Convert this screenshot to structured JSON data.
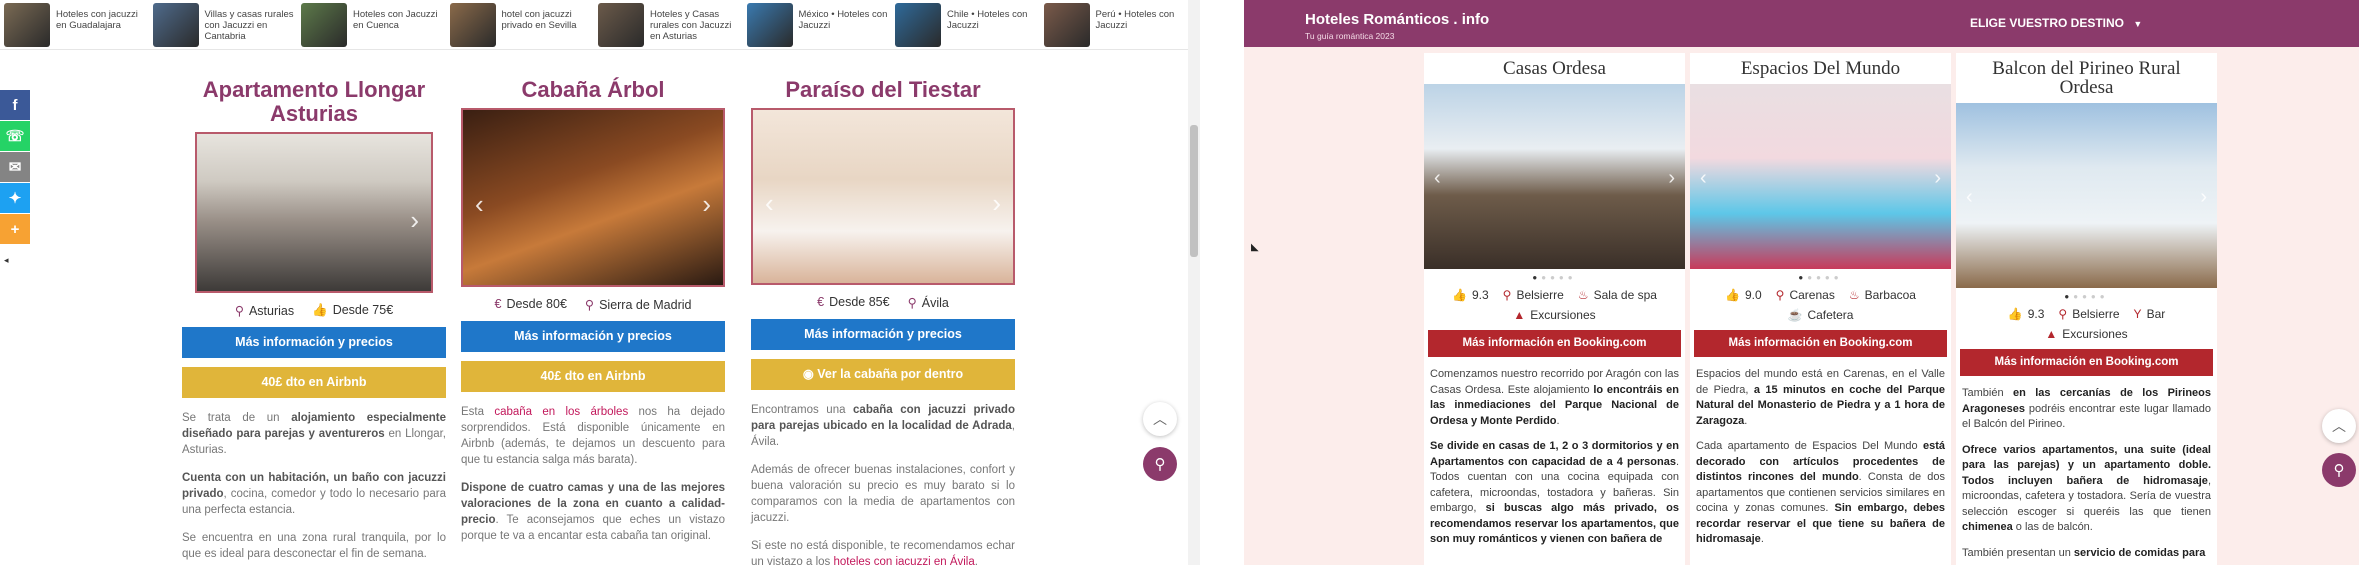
{
  "left": {
    "strip": [
      {
        "text": "Hoteles con jacuzzi en Guadalajara",
        "color": "#7a6a54"
      },
      {
        "text": "Villas y casas rurales con Jacuzzi en Cantabria",
        "color": "#4f6b8c"
      },
      {
        "text": "Hoteles con Jacuzzi en Cuenca",
        "color": "#5d7a4a"
      },
      {
        "text": "hotel con jacuzzi privado en Sevilla",
        "color": "#8a6a4a"
      },
      {
        "text": "Hoteles y Casas rurales con Jacuzzi en Asturias",
        "color": "#6b5a4a"
      },
      {
        "text": "México • Hoteles con Jacuzzi",
        "color": "#3a7ab0"
      },
      {
        "text": "Chile • Hoteles con Jacuzzi",
        "color": "#2f6a9a"
      },
      {
        "text": "Perú • Hoteles con Jacuzzi",
        "color": "#7a5a4a"
      }
    ],
    "share": [
      {
        "icon": "facebook-icon",
        "glyph": "f",
        "color": "#3b5998"
      },
      {
        "icon": "whatsapp-icon",
        "glyph": "☏",
        "color": "#25d366"
      },
      {
        "icon": "email-icon",
        "glyph": "✉",
        "color": "#848484"
      },
      {
        "icon": "twitter-icon",
        "glyph": "✦",
        "color": "#1da1f2"
      },
      {
        "icon": "more-icon",
        "glyph": "+",
        "color": "#f7a233"
      }
    ],
    "cards": [
      {
        "title": "Apartamento Llongar Asturias",
        "location": "Asturias",
        "price": "Desde 75€",
        "price_first": false,
        "btn_primary": "Más información y precios",
        "btn_secondary": "40£ dto en Airbnb",
        "paragraphs": [
          [
            {
              "t": "Se trata de un "
            },
            {
              "b": "alojamiento especialmente diseñado para parejas y aventureros"
            },
            {
              "t": " en Llongar, Asturias."
            }
          ],
          [
            {
              "b": "Cuenta con un habitación, un baño con jacuzzi privado"
            },
            {
              "t": ", cocina, comedor y todo lo necesario para una perfecta estancia."
            }
          ],
          [
            {
              "t": "Se encuentra en una zona rural tranquila, por lo que es ideal para desconectar el fin de semana."
            }
          ]
        ]
      },
      {
        "title": "Cabaña Árbol",
        "location": "Sierra de Madrid",
        "price": "Desde 80€",
        "price_first": true,
        "btn_primary": "Más información y precios",
        "btn_secondary": "40£ dto en Airbnb",
        "paragraphs": [
          [
            {
              "t": "Esta "
            },
            {
              "l": "cabaña en los árboles"
            },
            {
              "t": " nos ha dejado sorprendidos. Está disponible únicamente en Airbnb (además, te dejamos un descuento para que tu estancia salga más barata)."
            }
          ],
          [
            {
              "b": "Dispone de cuatro camas y una de las mejores valoraciones de la zona en cuanto a calidad-precio"
            },
            {
              "t": ". Te aconsejamos que eches un vistazo porque te va a encantar esta cabaña tan original."
            }
          ]
        ]
      },
      {
        "title": "Paraíso del Tiestar",
        "location": "Ávila",
        "price": "Desde 85€",
        "price_first": true,
        "btn_primary": "Más información y precios",
        "btn_secondary": "Ver la cabaña por dentro",
        "paragraphs": [
          [
            {
              "t": "Encontramos una "
            },
            {
              "b": "cabaña con jacuzzi privado para parejas ubicado en la localidad de Adrada"
            },
            {
              "t": ", Ávila."
            }
          ],
          [
            {
              "t": "Además de ofrecer buenas instalaciones, confort y buena valoración su precio es muy barato si lo comparamos con la media de apartamentos con jacuzzi."
            }
          ],
          [
            {
              "t": "Si este no está disponible, te recomendamos echar un vistazo a los "
            },
            {
              "l": "hoteles con jacuzzi en Ávila"
            },
            {
              "t": "."
            }
          ]
        ]
      }
    ]
  },
  "right": {
    "brand": "Hoteles Románticos . info",
    "tagline": "Tu guía romántica 2023",
    "menu_label": "ELIGE VUESTRO DESTINO",
    "cards": [
      {
        "title": "Casas Ordesa",
        "rating": "9.3",
        "amenities": [
          {
            "icon": "location-pin-icon",
            "glyph": "⚲",
            "text": "Belsierre"
          },
          {
            "icon": "spa-icon",
            "glyph": "♨",
            "text": "Sala de spa"
          },
          {
            "icon": "mountain-icon",
            "glyph": "▲",
            "text": "Excursiones"
          }
        ],
        "button": "Más información en Booking.com",
        "paragraphs": [
          [
            {
              "t": "Comenzamos nuestro recorrido por Aragón con las Casas Ordesa. Este alojamiento "
            },
            {
              "b": "lo encontráis en las inmediaciones del Parque Nacional de Ordesa y Monte Perdido"
            },
            {
              "t": "."
            }
          ],
          [
            {
              "b": "Se divide en casas de 1, 2 o 3 dormitorios y en Apartamentos con capacidad de a 4 personas"
            },
            {
              "t": ". Todos cuentan con una cocina equipada con cafetera, microondas, tostadora y bañeras. Sin embargo, "
            },
            {
              "b": "si buscas algo más privado, os recomendamos reservar los apartamentos, que son muy románticos y vienen con bañera de"
            }
          ]
        ]
      },
      {
        "title": "Espacios Del Mundo",
        "rating": "9.0",
        "amenities": [
          {
            "icon": "location-pin-icon",
            "glyph": "⚲",
            "text": "Carenas"
          },
          {
            "icon": "barbecue-icon",
            "glyph": "♨",
            "text": "Barbacoa"
          },
          {
            "icon": "coffee-icon",
            "glyph": "☕",
            "text": "Cafetera"
          }
        ],
        "button": "Más información en Booking.com",
        "paragraphs": [
          [
            {
              "t": "Espacios del mundo está en Carenas, en el Valle de Piedra, "
            },
            {
              "b": "a 15 minutos en coche del Parque Natural del Monasterio de Piedra y a 1 hora de Zaragoza"
            },
            {
              "t": "."
            }
          ],
          [
            {
              "t": "Cada apartamento de Espacios Del Mundo "
            },
            {
              "b": "está decorado con artículos procedentes de distintos rincones del mundo"
            },
            {
              "t": ". Consta de dos apartamentos que contienen servicios similares en cocina y zonas comunes. "
            },
            {
              "b": "Sin embargo, debes recordar reservar el que tiene su bañera de hidromasaje"
            },
            {
              "t": "."
            }
          ]
        ]
      },
      {
        "title": "Balcon del Pirineo Rural Ordesa",
        "rating": "9.3",
        "amenities": [
          {
            "icon": "location-pin-icon",
            "glyph": "⚲",
            "text": "Belsierre"
          },
          {
            "icon": "bar-icon",
            "glyph": "Y",
            "text": "Bar"
          },
          {
            "icon": "mountain-icon",
            "glyph": "▲",
            "text": "Excursiones"
          }
        ],
        "button": "Más información en Booking.com",
        "paragraphs": [
          [
            {
              "t": "También "
            },
            {
              "b": "en las cercanías de los Pirineos Aragoneses"
            },
            {
              "t": " podréis encontrar este lugar llamado el Balcón del Pirineo."
            }
          ],
          [
            {
              "b": "Ofrece varios apartamentos, una suite (ideal para las parejas) y un apartamento doble. Todos incluyen bañera de hidromasaje"
            },
            {
              "t": ", microondas, cafetera y tostadora. Sería de vuestra selección escoger si queréis las que tienen "
            },
            {
              "b": "chimenea"
            },
            {
              "t": " o las de balcón."
            }
          ],
          [
            {
              "t": "También presentan un "
            },
            {
              "b": "servicio de comidas para"
            }
          ]
        ]
      }
    ]
  }
}
